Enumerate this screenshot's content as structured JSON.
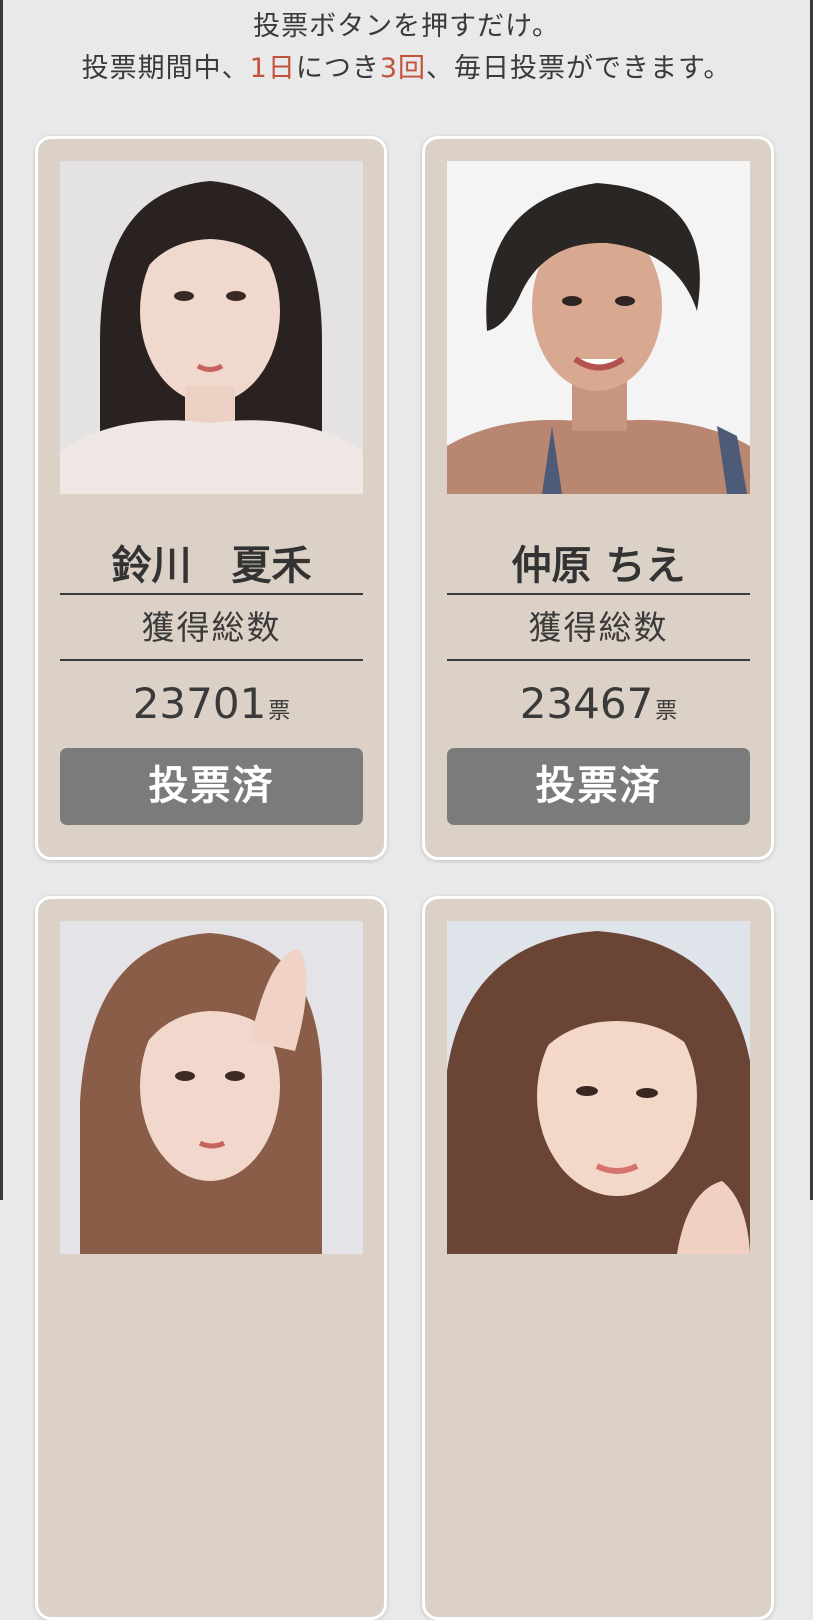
{
  "intro": {
    "line1": "投票ボタンを押すだけ。",
    "line2_a": "投票期間中、",
    "line2_b": "1日",
    "line2_c": "につき",
    "line2_d": "3回",
    "line2_e": "、毎日投票ができます。",
    "highlight_color": "#c0533a"
  },
  "cards": [
    {
      "name": "鈴川　夏禾",
      "total_label": "獲得総数",
      "votes": "23701",
      "unit": "票",
      "button": "投票済"
    },
    {
      "name": "仲原 ちえ",
      "total_label": "獲得総数",
      "votes": "23467",
      "unit": "票",
      "button": "投票済"
    },
    {
      "name": "",
      "total_label": "",
      "votes": "",
      "unit": "",
      "button": ""
    },
    {
      "name": "",
      "total_label": "",
      "votes": "",
      "unit": "",
      "button": ""
    }
  ],
  "colors": {
    "card_bg": "#dcd1c6",
    "button_bg": "#7b7b7b",
    "page_bg": "#e9e9e9"
  }
}
